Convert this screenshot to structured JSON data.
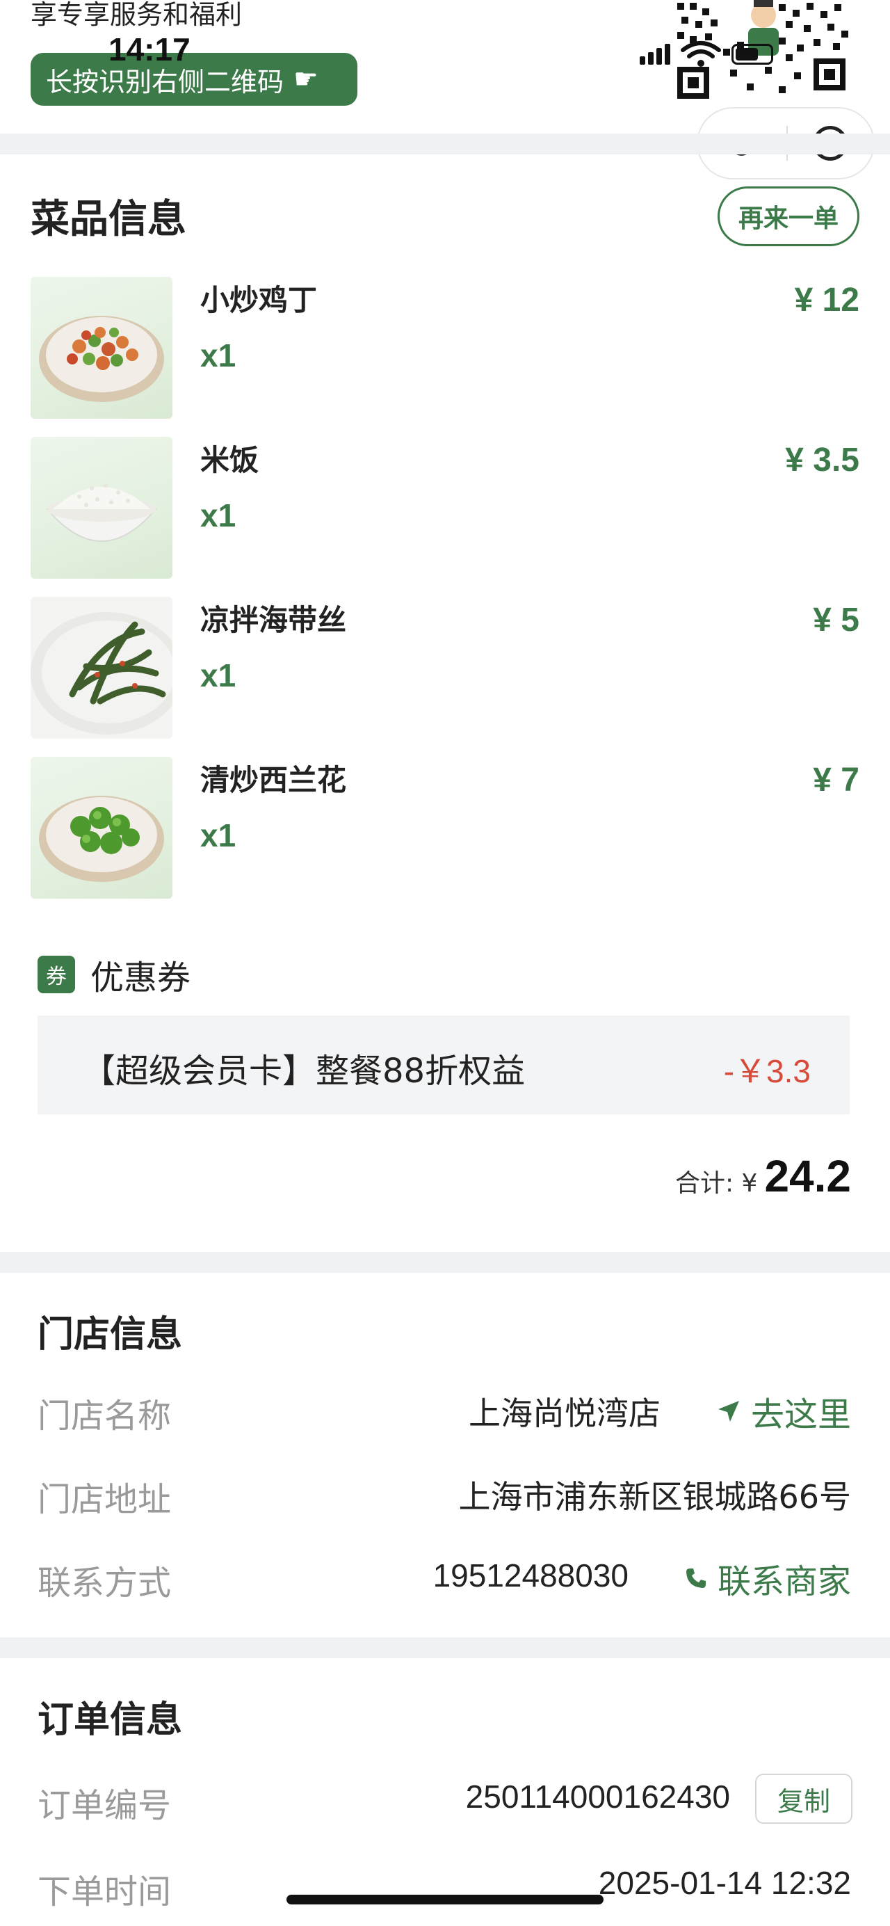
{
  "promo": {
    "text": "享专享服务和福利",
    "button_label": "长按识别右侧二维码",
    "hand_icon": "pointing-hand-icon"
  },
  "status_bar": {
    "time": "14:17"
  },
  "capsule": {
    "more_icon": "more-dots-icon",
    "target_icon": "target-icon"
  },
  "dishes": {
    "title": "菜品信息",
    "reorder_label": "再来一单",
    "items": [
      {
        "name": "小炒鸡丁",
        "qty": "x1",
        "price": "¥ 12",
        "image": "stir-fried-chicken-dish"
      },
      {
        "name": "米饭",
        "qty": "x1",
        "price": "¥ 3.5",
        "image": "rice-bowl"
      },
      {
        "name": "凉拌海带丝",
        "qty": "x1",
        "price": "¥ 5",
        "image": "seaweed-salad-dish"
      },
      {
        "name": "清炒西兰花",
        "qty": "x1",
        "price": "¥ 7",
        "image": "broccoli-dish"
      }
    ]
  },
  "coupon": {
    "tag": "券",
    "label": "优惠券",
    "name": "【超级会员卡】整餐88折权益",
    "amount": "-￥3.3"
  },
  "total": {
    "label": "合计: ¥",
    "value": "24.2"
  },
  "store": {
    "title": "门店信息",
    "name_label": "门店名称",
    "name_value": "上海尚悦湾店",
    "go_label": "去这里",
    "address_label": "门店地址",
    "address_value": "上海市浦东新区银城路66号",
    "contact_label": "联系方式",
    "contact_value": "19512488030",
    "contact_link": "联系商家"
  },
  "order": {
    "title": "订单信息",
    "number_label": "订单编号",
    "number_value": "250114000162430",
    "copy_label": "复制",
    "time_label": "下单时间",
    "time_value": "2025-01-14 12:32"
  },
  "colors": {
    "brand_green": "#3c7a4a",
    "discount_red": "#d84a3a",
    "divider_gray": "#eef2f4"
  }
}
